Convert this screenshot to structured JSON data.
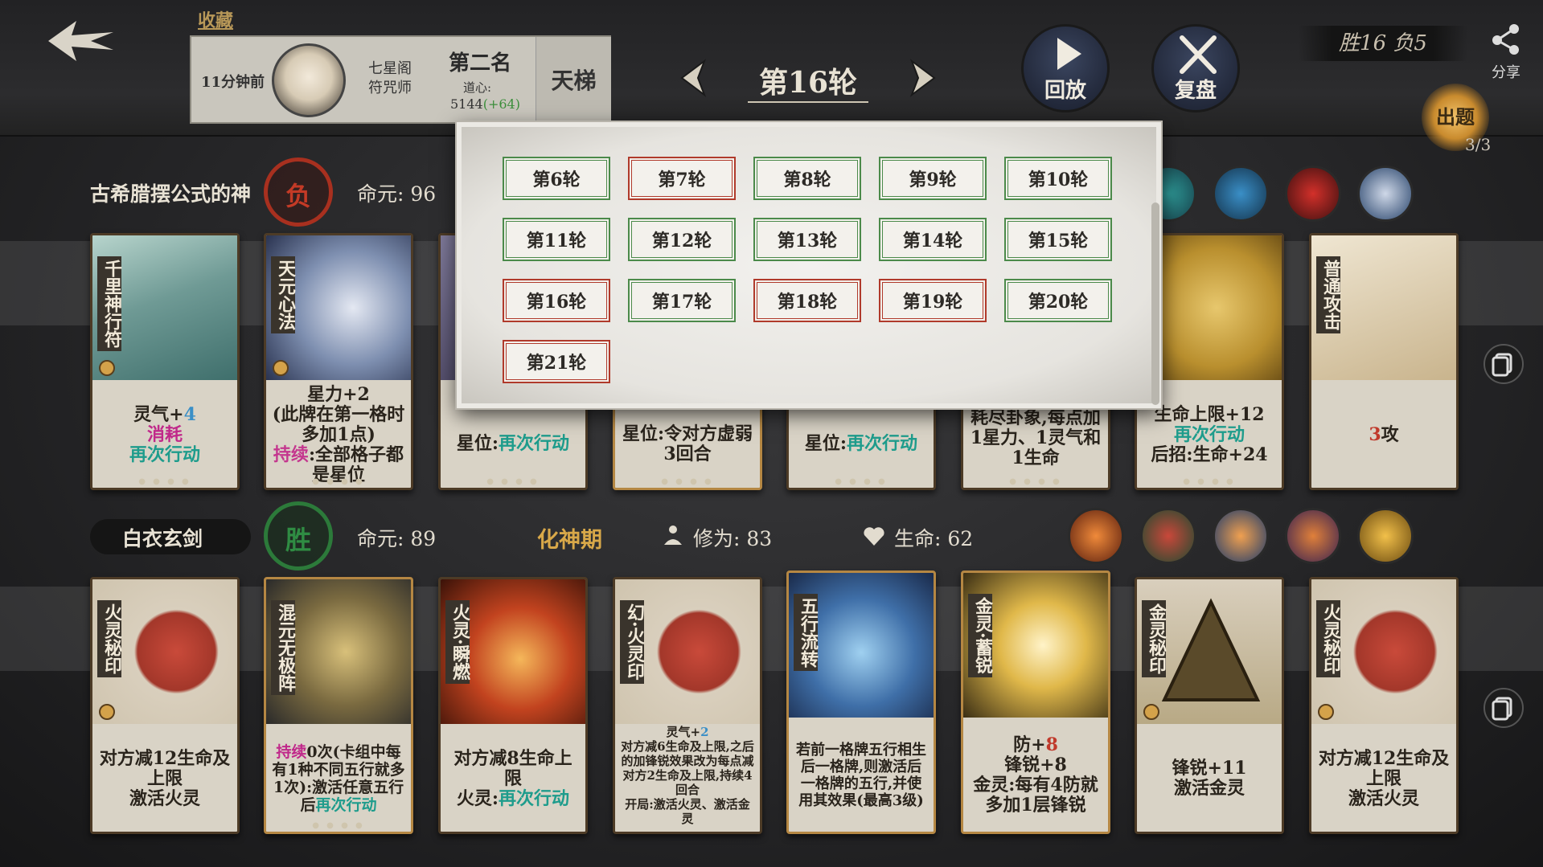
{
  "header": {
    "favorites_label": "收藏",
    "opponent": {
      "time_ago": "11分钟前",
      "sect_line1": "七星阁",
      "sect_line2": "符咒师",
      "rank": "第二名",
      "daoxin_label": "道心:",
      "daoxin_value": "5144",
      "daoxin_delta": "(+64)",
      "ladder_label": "天梯"
    },
    "round_title": "第16轮",
    "play_label": "回放",
    "review_label": "复盘",
    "score": "胜16 负5",
    "share_label": "分享",
    "quiz_label": "出题",
    "quiz_count": "3/3"
  },
  "round_selector": {
    "rounds": [
      {
        "label": "第6轮",
        "result": "win"
      },
      {
        "label": "第7轮",
        "result": "lose"
      },
      {
        "label": "第8轮",
        "result": "win"
      },
      {
        "label": "第9轮",
        "result": "win"
      },
      {
        "label": "第10轮",
        "result": "win"
      },
      {
        "label": "第11轮",
        "result": "win"
      },
      {
        "label": "第12轮",
        "result": "win"
      },
      {
        "label": "第13轮",
        "result": "win"
      },
      {
        "label": "第14轮",
        "result": "win"
      },
      {
        "label": "第15轮",
        "result": "win"
      },
      {
        "label": "第16轮",
        "result": "lose"
      },
      {
        "label": "第17轮",
        "result": "win"
      },
      {
        "label": "第18轮",
        "result": "lose"
      },
      {
        "label": "第19轮",
        "result": "lose"
      },
      {
        "label": "第20轮",
        "result": "win"
      },
      {
        "label": "第21轮",
        "result": "lose"
      }
    ]
  },
  "opponent_row": {
    "name": "古希腊摆公式的神",
    "result": "负",
    "mingyuan_label": "命元:",
    "mingyuan_value": "96",
    "cards": [
      {
        "name": "千里神行符",
        "lines": [
          [
            "灵气+",
            ""
          ],
          [
            "4",
            "c-blue"
          ]
        ],
        "desc_html_key": "c0"
      },
      {
        "name": "天元心法"
      },
      {
        "name": ""
      },
      {
        "name": ""
      },
      {
        "name": ""
      },
      {
        "name": ""
      },
      {
        "name": ""
      },
      {
        "name": "普通攻击"
      }
    ],
    "card_texts": {
      "c0_l1a": "灵气+",
      "c0_l1b": "4",
      "c0_l2": "消耗",
      "c0_l3": "再次行动",
      "c1_l1": "星力+2",
      "c1_l2": "(此牌在第一格时多加1点)",
      "c1_l3a": "持续",
      "c1_l3b": ":全部格子都是星位",
      "c2_l1a": "星位:",
      "c2_l1b": "再次行动",
      "c3_l1": "星位:令对方虚弱3回合",
      "c4_l1a": "星位:",
      "c4_l1b": "再次行动",
      "c5_l1": "耗尽卦象,每点加1星力、1灵气和1生命",
      "c6_l1": "生命上限+12",
      "c6_l2": "再次行动",
      "c6_l3": "后招:生命+24",
      "c7_l1a": "3",
      "c7_l1b": "攻"
    }
  },
  "player_row": {
    "name": "白衣玄剑",
    "result": "胜",
    "mingyuan_label": "命元:",
    "mingyuan_value": "89",
    "realm": "化神期",
    "xiuwei_label": "修为:",
    "xiuwei_value": "83",
    "life_label": "生命:",
    "life_value": "62",
    "cards": [
      {
        "name": "火灵秘印",
        "t1": "对方减12生命及上限",
        "t2": "激活火灵"
      },
      {
        "name": "混元无极阵",
        "t1a": "持续",
        "t1b": "0次(卡组中每有1种不同五行就多1次):激活任意五行后",
        "t1c": "再次行动"
      },
      {
        "name": "火灵·瞬燃",
        "t1": "对方减8生命上限",
        "t2a": "火灵:",
        "t2b": "再次行动"
      },
      {
        "name": "幻·火灵印",
        "t0a": "灵气+",
        "t0b": "2",
        "t1": "对方减6生命及上限,之后的加锋锐效果改为每点减对方2生命及上限,持续4回合",
        "t2": "开局:激活火灵、激活金灵"
      },
      {
        "name": "五行流转",
        "t1": "若前一格牌五行相生后一格牌,则激活后一格牌的五行,并使用其效果(最高3级)"
      },
      {
        "name": "金灵·蓄锐",
        "t1a": "防+",
        "t1b": "8",
        "t2": "锋锐+8",
        "t3": "金灵:每有4防就多加1层锋锐"
      },
      {
        "name": "金灵秘印",
        "t1": "锋锐+11",
        "t2": "激活金灵"
      },
      {
        "name": "火灵秘印",
        "t1": "对方减12生命及上限",
        "t2": "激活火灵"
      }
    ]
  },
  "colors": {
    "win": "#4b8a4a",
    "lose": "#b03a2b",
    "realm": "#d8a849",
    "daoxin_delta": "#3c8f3c"
  }
}
